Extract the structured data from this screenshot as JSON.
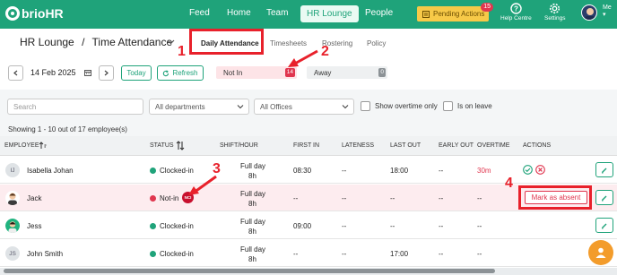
{
  "brand": {
    "name": "brioHR"
  },
  "nav": {
    "items": [
      {
        "label": "Feed",
        "active": false
      },
      {
        "label": "Home",
        "active": false
      },
      {
        "label": "Team",
        "active": false
      },
      {
        "label": "HR Lounge",
        "active": true
      },
      {
        "label": "People",
        "active": false
      }
    ],
    "pending_label": "Pending Actions",
    "pending_count": "15",
    "help_label": "Help Centre",
    "settings_label": "Settings",
    "user_label": "Me"
  },
  "header": {
    "crumb_root": "HR Lounge",
    "crumb_sep": "/",
    "crumb_current": "Time Attendance",
    "tabs": [
      "Daily Attendance",
      "Timesheets",
      "Rostering",
      "Policy"
    ]
  },
  "datebar": {
    "date": "14 Feb 2025",
    "today_label": "Today",
    "refresh_label": "Refresh",
    "not_in_label": "Not In",
    "not_in_count": "14",
    "away_label": "Away",
    "away_count": "0"
  },
  "filters": {
    "search_placeholder": "Search",
    "departments": "All departments",
    "offices": "All Offices",
    "overtime_label": "Show overtime only",
    "leave_label": "Is on leave"
  },
  "showing": "Showing 1 - 10 out of 17 employee(s)",
  "table": {
    "headers": [
      "Employee",
      "Status",
      "Shift/Hour",
      "First in",
      "Lateness",
      "Last out",
      "Early out",
      "Overtime",
      "Actions"
    ],
    "rows": [
      {
        "initials": "IJ",
        "name": "Isabella Johan",
        "status": "Clocked-in",
        "shift": "Full day",
        "hours": "8h",
        "first_in": "08:30",
        "lateness": "--",
        "last_out": "18:00",
        "early_out": "--",
        "overtime": "30m"
      },
      {
        "initials": "",
        "name": "Jack",
        "status": "Not-in",
        "badge": "NCI",
        "shift": "Full day",
        "hours": "8h",
        "first_in": "--",
        "lateness": "--",
        "last_out": "--",
        "early_out": "--",
        "overtime": "--",
        "action": "Mark as absent"
      },
      {
        "initials": "",
        "name": "Jess",
        "status": "Clocked-in",
        "shift": "Full day",
        "hours": "8h",
        "first_in": "09:00",
        "lateness": "--",
        "last_out": "--",
        "early_out": "--",
        "overtime": "--"
      },
      {
        "initials": "JS",
        "name": "John Smith",
        "status": "Clocked-in",
        "shift": "Full day",
        "hours": "8h",
        "first_in": "--",
        "lateness": "--",
        "last_out": "17:00",
        "early_out": "--",
        "overtime": "--"
      }
    ]
  },
  "annotations": [
    "1",
    "2",
    "3",
    "4"
  ],
  "colors": {
    "brand": "#1fa37a",
    "alert": "#e0364f",
    "annotation": "#e8212b",
    "pending": "#f7c948"
  }
}
